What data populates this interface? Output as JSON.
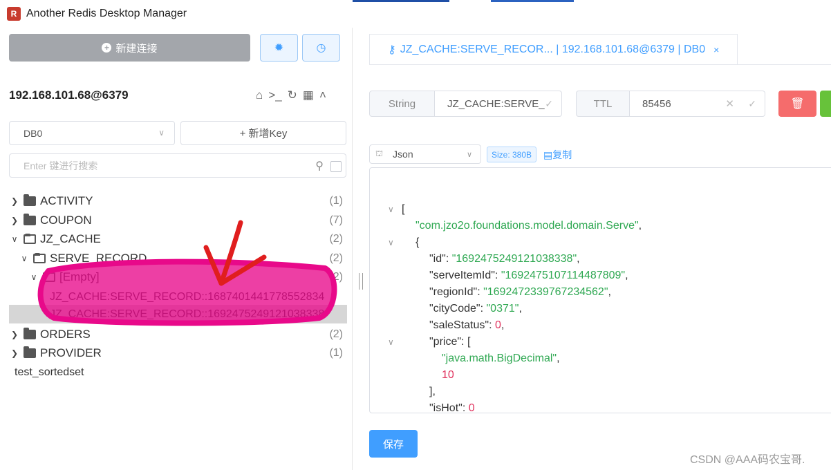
{
  "window": {
    "title": "Another Redis Desktop Manager",
    "logo_glyph": "R"
  },
  "sidebar": {
    "new_connection_label": "新建连接",
    "connection_name": "192.168.101.68@6379",
    "db_select_value": "DB0",
    "add_key_label": "+ 新增Key",
    "search_placeholder": "Enter 键进行搜索",
    "tree": [
      {
        "label": "ACTIVITY",
        "count": "(1)"
      },
      {
        "label": "COUPON",
        "count": "(7)"
      },
      {
        "label": "JZ_CACHE",
        "count": "(2)"
      },
      {
        "label": "SERVE_RECORD",
        "count": "(2)"
      },
      {
        "label": "[Empty]",
        "count": "(2)"
      },
      {
        "label": "JZ_CACHE:SERVE_RECORD::1687401441778552834",
        "count": ""
      },
      {
        "label": "JZ_CACHE:SERVE_RECORD::1692475249121038338",
        "count": ""
      },
      {
        "label": "ORDERS",
        "count": "(2)"
      },
      {
        "label": "PROVIDER",
        "count": "(1)"
      },
      {
        "label": "test_sortedset",
        "count": ""
      }
    ]
  },
  "tab": {
    "label": "JZ_CACHE:SERVE_RECOR... | 192.168.101.68@6379 | DB0",
    "close": "×"
  },
  "key_header": {
    "type_label": "String",
    "key_value": "JZ_CACHE:SERVE_",
    "ttl_label": "TTL",
    "ttl_value": "85456"
  },
  "viewer": {
    "format": "Json",
    "size_tag": "Size: 380B",
    "copy_label": "复制",
    "lines": [
      {
        "t": "["
      },
      {
        "s": "\"com.jzo2o.foundations.model.domain.Serve\"",
        "tail": ","
      },
      {
        "t": "{"
      },
      {
        "k": "\"id\"",
        "s": "\"1692475249121038338\"",
        "tail": ","
      },
      {
        "k": "\"serveItemId\"",
        "s": "\"1692475107114487809\"",
        "tail": ","
      },
      {
        "k": "\"regionId\"",
        "s": "\"1692472339767234562\"",
        "tail": ","
      },
      {
        "k": "\"cityCode\"",
        "s": "\"0371\"",
        "tail": ","
      },
      {
        "k": "\"saleStatus\"",
        "n": "0",
        "tail": ","
      },
      {
        "k": "\"price\"",
        "t": ": ["
      },
      {
        "s": "\"java.math.BigDecimal\"",
        "tail": ","
      },
      {
        "n": "10"
      },
      {
        "t": "],"
      },
      {
        "k": "\"isHot\"",
        "n": "0"
      }
    ]
  },
  "save_label": "保存",
  "watermark": "CSDN @AAA码农宝哥.",
  "colors": {
    "accent": "#409eff",
    "danger": "#f56c6c",
    "success": "#67c23a",
    "annotation": "#e8098a",
    "arrow": "#e01e1e"
  }
}
